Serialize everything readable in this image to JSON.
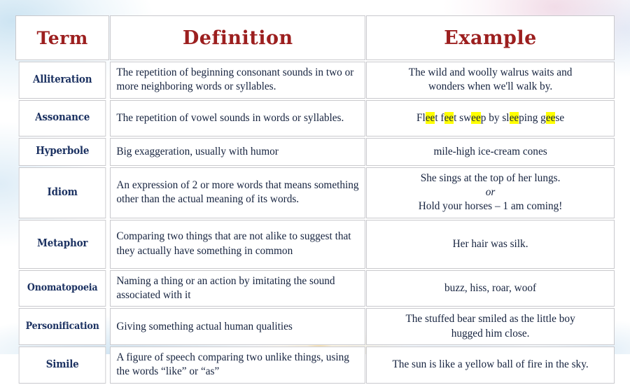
{
  "table": {
    "headers": {
      "term": "Term",
      "definition": "Definition",
      "example": "Example"
    },
    "rows": [
      {
        "term": "Alliteration",
        "definition": "The repetition of beginning consonant sounds in two or more neighboring words or syllables.",
        "example_line1": "The wild and woolly walrus waits and",
        "example_line2": "wonders when we'll walk by."
      },
      {
        "term": "Assonance",
        "definition": "The repetition of vowel sounds in words or syllables.",
        "example_parts": [
          "Fl",
          "ee",
          "t f",
          "ee",
          "t sw",
          "ee",
          "p by sl",
          "ee",
          "ping g",
          "ee",
          "se"
        ],
        "example_plain": "Fleet feet sweep by sleeping geese"
      },
      {
        "term": "Hyperbole",
        "definition": "Big exaggeration, usually with humor",
        "example_line1": "mile-high ice-cream cones"
      },
      {
        "term": "Idiom",
        "definition": "An expression of 2 or more words that means something other than the actual meaning of its words.",
        "example_line1": "She sings at the top of her lungs.",
        "example_line2": "or",
        "example_line3": "Hold your horses – 1 am coming!"
      },
      {
        "term": "Metaphor",
        "definition": "Comparing two things that are not alike to suggest that they actually have something in common",
        "example_line1": "Her hair was silk."
      },
      {
        "term": "Onomatopoeia",
        "definition": "Naming a thing or an action by imitating the sound associated with it",
        "example_line1": "buzz, hiss, roar, woof"
      },
      {
        "term": "Personification",
        "definition": "Giving something actual human qualities",
        "example_line1": "The stuffed bear smiled as the little boy",
        "example_line2": "hugged him close."
      },
      {
        "term": "Simile",
        "definition": "A figure of speech comparing two unlike things, using the words “like” or “as”",
        "example_line1": "The sun is like a yellow ball of fire in the sky."
      }
    ]
  },
  "colors": {
    "header_text": "#9c1f1f",
    "term_text": "#1b3161",
    "body_text": "#16233f",
    "cell_border": "#c9c9cd",
    "highlight": "#ffff00",
    "cell_background": "#ffffff"
  }
}
